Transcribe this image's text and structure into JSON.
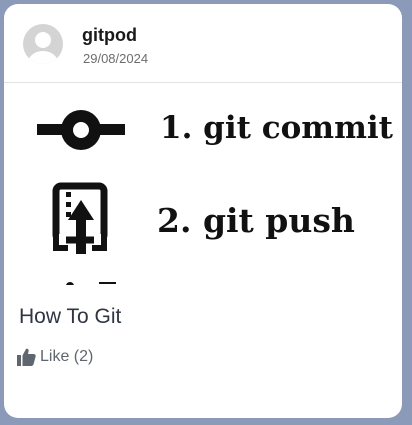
{
  "post": {
    "username": "gitpod",
    "date": "29/08/2024",
    "title": "How To Git",
    "like_label": "Like (2)",
    "image": {
      "line1": "1. git commit",
      "line2": "2. git push"
    }
  },
  "icons": {
    "avatar": "user-avatar-icon",
    "commit": "git-commit-icon",
    "push": "git-push-icon",
    "like": "thumbs-up-icon"
  },
  "colors": {
    "page_background": "#8a9ab8",
    "card_background": "#ffffff",
    "text_primary": "#1a1a1a",
    "text_secondary": "#6d6d6d",
    "title_color": "#2f3542"
  }
}
